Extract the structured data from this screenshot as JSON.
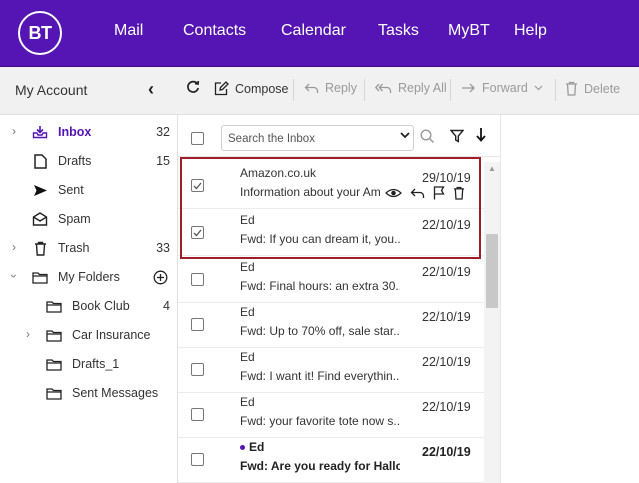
{
  "brand": {
    "logo_text": "BT",
    "accent": "#5514b4"
  },
  "nav": [
    {
      "label": "Mail"
    },
    {
      "label": "Contacts"
    },
    {
      "label": "Calendar"
    },
    {
      "label": "Tasks"
    },
    {
      "label": "MyBT"
    },
    {
      "label": "Help"
    }
  ],
  "sidebar": {
    "title": "My Account",
    "collapse_icon": "chevron-left-icon",
    "items": [
      {
        "label": "Inbox",
        "count": "32",
        "icon": "inbox-icon",
        "has_chevron": true,
        "active": true
      },
      {
        "label": "Drafts",
        "count": "15",
        "icon": "document-icon"
      },
      {
        "label": "Sent",
        "count": "",
        "icon": "send-icon"
      },
      {
        "label": "Spam",
        "count": "",
        "icon": "spam-icon"
      },
      {
        "label": "Trash",
        "count": "33",
        "icon": "trash-icon",
        "has_chevron": true
      },
      {
        "label": "My Folders",
        "count": "",
        "icon": "folder-icon",
        "has_chevron": true,
        "action_icon": "add-circle-icon"
      },
      {
        "label": "Book Club",
        "count": "4",
        "icon": "folder-icon"
      },
      {
        "label": "Car Insurance",
        "count": "",
        "icon": "folder-icon",
        "has_chevron": true
      },
      {
        "label": "Drafts_1",
        "count": "",
        "icon": "folder-icon"
      },
      {
        "label": "Sent Messages",
        "count": "",
        "icon": "folder-icon"
      }
    ]
  },
  "toolbar": {
    "refresh_icon": "refresh-icon",
    "compose": "Compose",
    "reply": "Reply",
    "reply_all": "Reply All",
    "forward": "Forward",
    "delete": "Delete"
  },
  "list": {
    "search_placeholder": "Search the Inbox",
    "messages": [
      {
        "from": "Amazon.co.uk",
        "subject": "Information about your Amazon",
        "date": "29/10/19",
        "checked": true,
        "hovered": true
      },
      {
        "from": "Ed",
        "subject": "Fwd: If you can dream it, you...",
        "date": "22/10/19",
        "checked": true
      },
      {
        "from": "Ed",
        "subject": "Fwd: Final hours: an extra 30...",
        "date": "22/10/19"
      },
      {
        "from": "Ed",
        "subject": "Fwd: Up to 70% off, sale star...",
        "date": "22/10/19"
      },
      {
        "from": "Ed",
        "subject": "Fwd: I want it! Find everythin...",
        "date": "22/10/19"
      },
      {
        "from": "Ed",
        "subject": "Fwd: your favorite tote now s...",
        "date": "22/10/19"
      },
      {
        "from": "Ed",
        "subject": "Fwd: Are you ready for Hallo...",
        "date": "22/10/19",
        "unread": true
      }
    ]
  },
  "colors": {
    "topbar": "#5514b4",
    "selection_outline": "#a01d2a"
  }
}
